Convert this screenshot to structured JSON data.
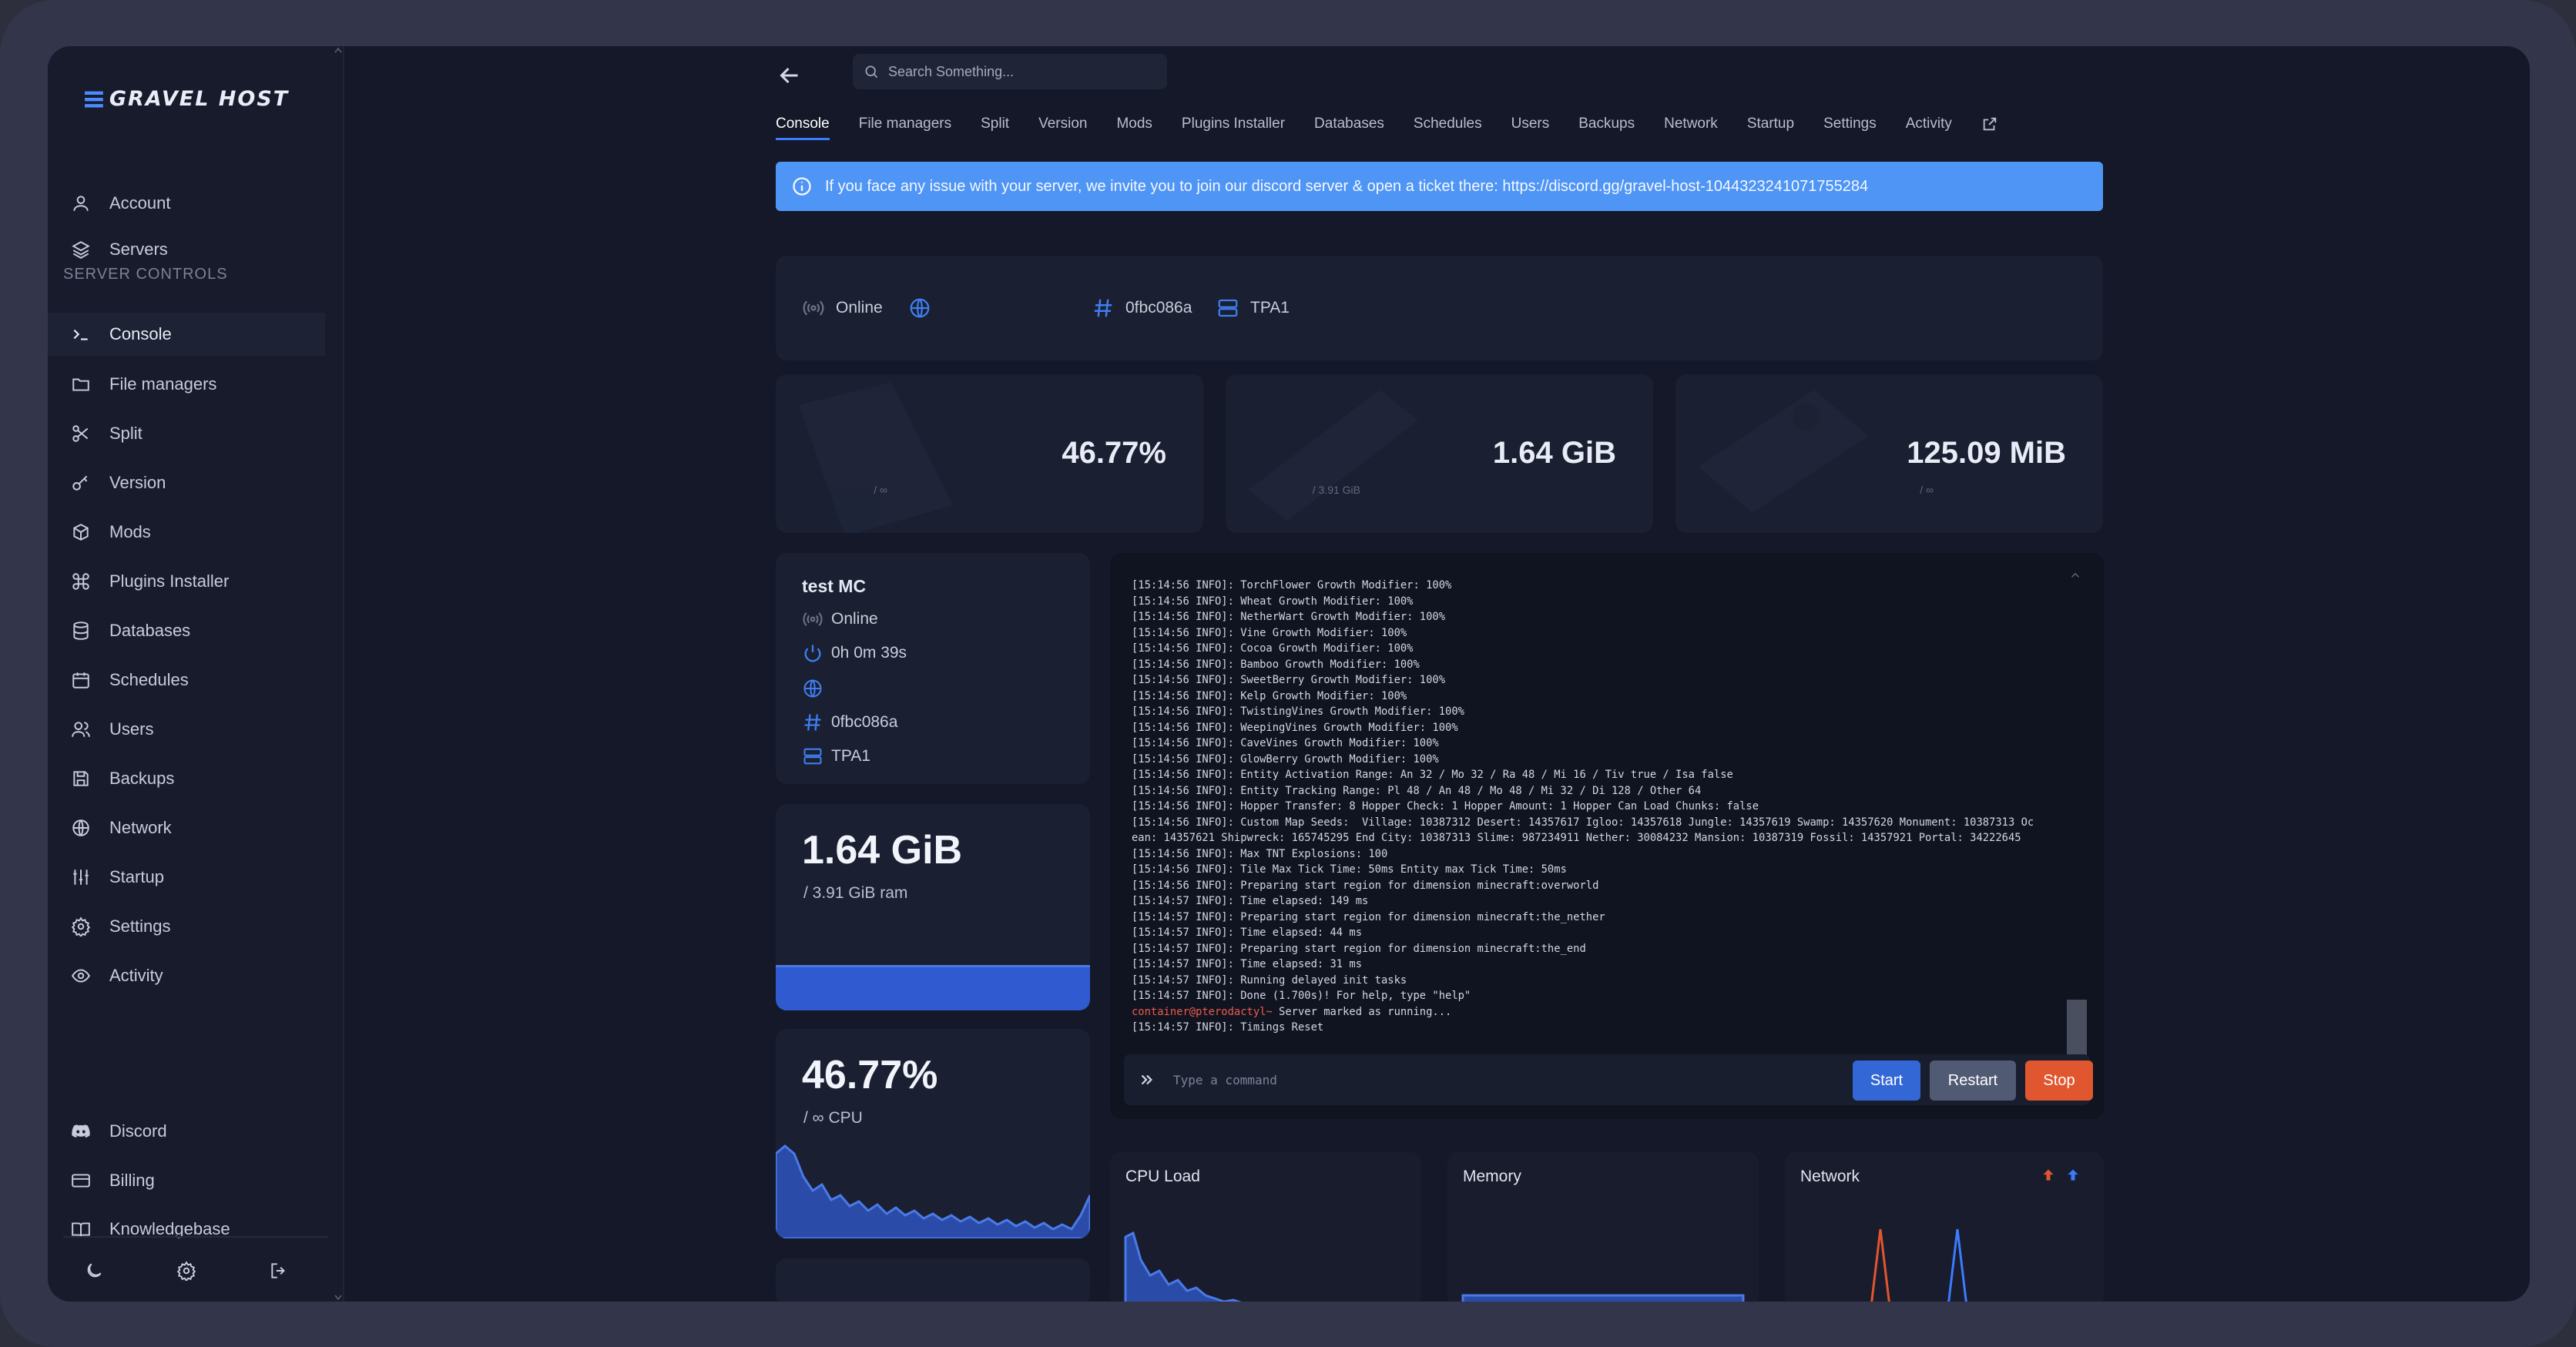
{
  "brand": {
    "logo_text": "GRAVEL HOST"
  },
  "sidebar": {
    "top_items": [
      {
        "label": "Account",
        "icon": "user-icon"
      },
      {
        "label": "Servers",
        "icon": "layers-icon"
      }
    ],
    "section_title": "SERVER CONTROLS",
    "items": [
      {
        "label": "Console",
        "icon": "terminal-icon"
      },
      {
        "label": "File managers",
        "icon": "folder-icon"
      },
      {
        "label": "Split",
        "icon": "scissors-icon"
      },
      {
        "label": "Version",
        "icon": "key-icon"
      },
      {
        "label": "Mods",
        "icon": "puzzle-icon"
      },
      {
        "label": "Plugins Installer",
        "icon": "command-icon"
      },
      {
        "label": "Databases",
        "icon": "database-icon"
      },
      {
        "label": "Schedules",
        "icon": "calendar-icon"
      },
      {
        "label": "Users",
        "icon": "users-icon"
      },
      {
        "label": "Backups",
        "icon": "save-icon"
      },
      {
        "label": "Network",
        "icon": "globe-icon"
      },
      {
        "label": "Startup",
        "icon": "sliders-icon"
      },
      {
        "label": "Settings",
        "icon": "gear-icon"
      },
      {
        "label": "Activity",
        "icon": "eye-icon"
      }
    ],
    "footer_items": [
      {
        "label": "Discord",
        "icon": "discord-icon"
      },
      {
        "label": "Billing",
        "icon": "credit-card-icon"
      },
      {
        "label": "Knowledgebase",
        "icon": "book-icon"
      }
    ]
  },
  "search": {
    "placeholder": "Search Something..."
  },
  "tabs": [
    "Console",
    "File managers",
    "Split",
    "Version",
    "Mods",
    "Plugins Installer",
    "Databases",
    "Schedules",
    "Users",
    "Backups",
    "Network",
    "Startup",
    "Settings",
    "Activity"
  ],
  "banner": {
    "text": "If you face any issue with your server, we invite you to join our discord server & open a ticket there: https://discord.gg/gravel-host-1044323241071755284"
  },
  "status": {
    "state": "Online",
    "id": "0fbc086a",
    "node": "TPA1"
  },
  "stats": {
    "cpu": {
      "value": "46.77%",
      "sub": "/ ∞"
    },
    "ram": {
      "value": "1.64 GiB",
      "sub": "/ 3.91 GiB"
    },
    "disk": {
      "value": "125.09 MiB",
      "sub": "/ ∞"
    }
  },
  "server_info": {
    "name": "test MC",
    "state": "Online",
    "uptime": "0h 0m 39s",
    "id": "0fbc086a",
    "node": "TPA1"
  },
  "ram_card": {
    "value": "1.64 GiB",
    "sub": "/ 3.91 GiB ram",
    "fill_fraction": 0.42
  },
  "cpu_card": {
    "value": "46.77%",
    "sub": "/ ∞ CPU"
  },
  "console": {
    "lines": [
      "[15:14:56 INFO]: TorchFlower Growth Modifier: 100%",
      "[15:14:56 INFO]: Wheat Growth Modifier: 100%",
      "[15:14:56 INFO]: NetherWart Growth Modifier: 100%",
      "[15:14:56 INFO]: Vine Growth Modifier: 100%",
      "[15:14:56 INFO]: Cocoa Growth Modifier: 100%",
      "[15:14:56 INFO]: Bamboo Growth Modifier: 100%",
      "[15:14:56 INFO]: SweetBerry Growth Modifier: 100%",
      "[15:14:56 INFO]: Kelp Growth Modifier: 100%",
      "[15:14:56 INFO]: TwistingVines Growth Modifier: 100%",
      "[15:14:56 INFO]: WeepingVines Growth Modifier: 100%",
      "[15:14:56 INFO]: CaveVines Growth Modifier: 100%",
      "[15:14:56 INFO]: GlowBerry Growth Modifier: 100%",
      "[15:14:56 INFO]: Entity Activation Range: An 32 / Mo 32 / Ra 48 / Mi 16 / Tiv true / Isa false",
      "[15:14:56 INFO]: Entity Tracking Range: Pl 48 / An 48 / Mo 48 / Mi 32 / Di 128 / Other 64",
      "[15:14:56 INFO]: Hopper Transfer: 8 Hopper Check: 1 Hopper Amount: 1 Hopper Can Load Chunks: false",
      "[15:14:56 INFO]: Custom Map Seeds:  Village: 10387312 Desert: 14357617 Igloo: 14357618 Jungle: 14357619 Swamp: 14357620 Monument: 10387313 Oc",
      "ean: 14357621 Shipwreck: 165745295 End City: 10387313 Slime: 987234911 Nether: 30084232 Mansion: 10387319 Fossil: 14357921 Portal: 34222645",
      "[15:14:56 INFO]: Max TNT Explosions: 100",
      "[15:14:56 INFO]: Tile Max Tick Time: 50ms Entity max Tick Time: 50ms",
      "[15:14:56 INFO]: Preparing start region for dimension minecraft:overworld",
      "[15:14:57 INFO]: Time elapsed: 149 ms",
      "[15:14:57 INFO]: Preparing start region for dimension minecraft:the_nether",
      "[15:14:57 INFO]: Time elapsed: 44 ms",
      "[15:14:57 INFO]: Preparing start region for dimension minecraft:the_end",
      "[15:14:57 INFO]: Time elapsed: 31 ms",
      "[15:14:57 INFO]: Running delayed init tasks",
      "[15:14:57 INFO]: Done (1.700s)! For help, type \"help\""
    ],
    "prompt_user": "container@pterodactyl~",
    "prompt_text": " Server marked as running...",
    "last_line": "[15:14:57 INFO]: Timings Reset",
    "input_placeholder": "Type a command",
    "buttons": {
      "start": "Start",
      "restart": "Restart",
      "stop": "Stop"
    }
  },
  "graphs": {
    "cpu_title": "CPU Load",
    "memory_title": "Memory",
    "network_title": "Network"
  },
  "colors": {
    "accent": "#3b7cff",
    "banner": "#4f95f6",
    "stop": "#e0562f",
    "background": "#141828"
  }
}
